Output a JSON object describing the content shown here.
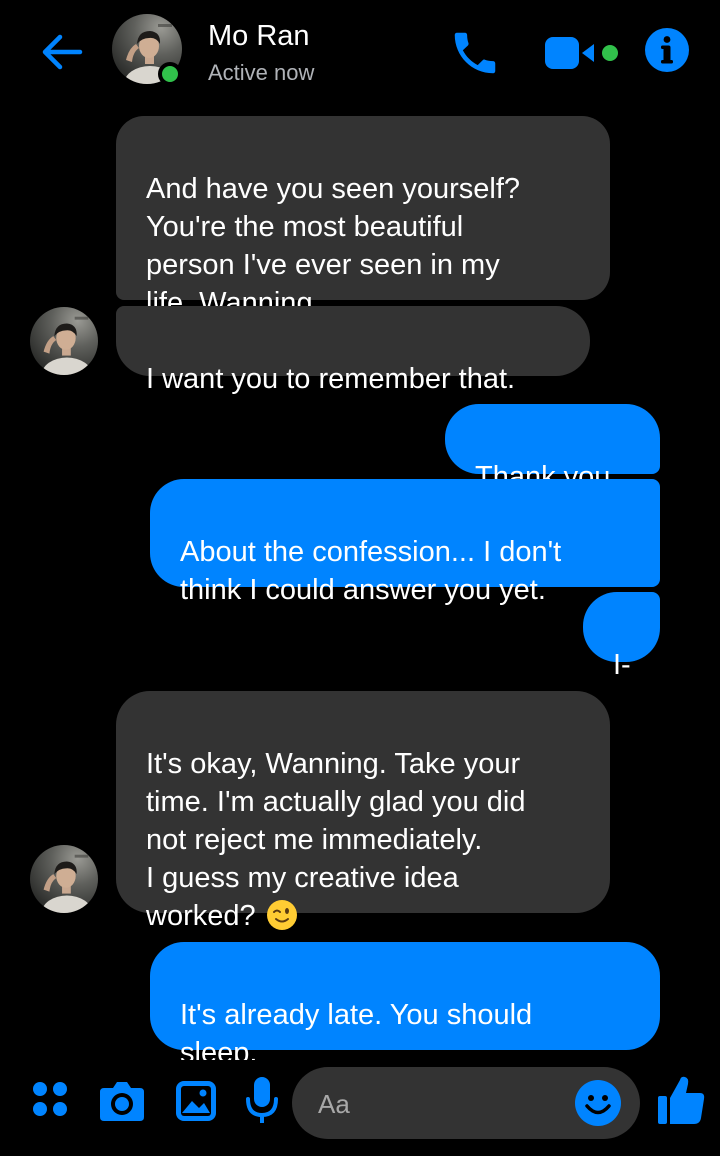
{
  "header": {
    "contact_name": "Mo Ran",
    "status": "Active now",
    "icons": [
      "back-arrow-icon",
      "phone-icon",
      "video-camera-icon",
      "info-icon"
    ]
  },
  "messages": [
    {
      "sender": "Mo Ran",
      "direction": "incoming",
      "text": "And have you seen yourself?\nYou're the most beautiful\nperson I've ever seen in my\nlife, Wanning."
    },
    {
      "sender": "Mo Ran",
      "direction": "incoming",
      "text": "I want you to remember that."
    },
    {
      "sender": "me",
      "direction": "outgoing",
      "text": "Thank you."
    },
    {
      "sender": "me",
      "direction": "outgoing",
      "text": "About the confession... I don't\nthink I could answer you yet."
    },
    {
      "sender": "me",
      "direction": "outgoing",
      "text": "I-"
    },
    {
      "sender": "Mo Ran",
      "direction": "incoming",
      "text": "It's okay, Wanning. Take your\ntime. I'm actually glad you did\nnot reject me immediately.\nI guess my creative idea\nworked? ",
      "emoji": "winking-face"
    },
    {
      "sender": "me",
      "direction": "outgoing",
      "text": "It's already late. You should\nsleep."
    }
  ],
  "composer": {
    "placeholder": "Aa",
    "icons": [
      "menu-dots-icon",
      "camera-icon",
      "gallery-icon",
      "microphone-icon",
      "emoji-icon",
      "thumbs-up-icon"
    ]
  },
  "colors": {
    "background": "#000000",
    "accent": "#0084ff",
    "incoming_bubble": "#333333",
    "outgoing_bubble": "#0084ff",
    "online_indicator": "#31c14b",
    "secondary_text": "#b0b3b8"
  }
}
